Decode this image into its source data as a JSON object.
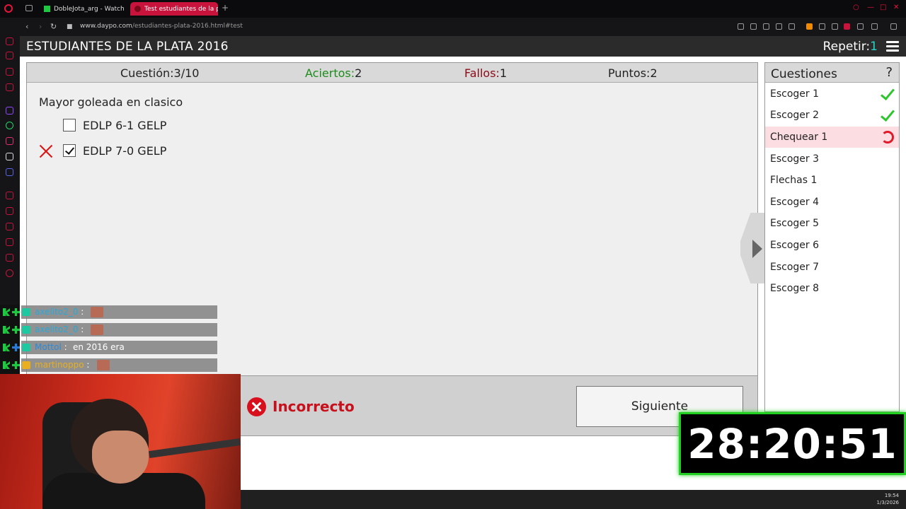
{
  "browser": {
    "tabs": [
      {
        "label": "DobleJota_arg - Watch clip",
        "active": false
      },
      {
        "label": "Test estudiantes de la plata",
        "active": true
      }
    ],
    "new_tab": "+",
    "url_host": "www.daypo.com",
    "url_path": "/estudiantes-plata-2016.html#test",
    "nav": {
      "back": "‹",
      "forward": "›",
      "reload": "↻"
    }
  },
  "header": {
    "title": "ESTUDIANTES DE LA PLATA 2016",
    "repeat_label": "Repetir:",
    "repeat_value": "1"
  },
  "stats": {
    "question_label": "Cuestión:",
    "question_value": "3/10",
    "correct_label": "Aciertos:",
    "correct_value": "2",
    "wrong_label": "Fallos:",
    "wrong_value": "1",
    "points_label": "Puntos:",
    "points_value": "2",
    "colors": {
      "correct": "#1c8c1c",
      "wrong": "#8b0b16"
    }
  },
  "question": {
    "text": "Mayor goleada en clasico",
    "options": [
      {
        "label": "EDLP 6-1 GELP",
        "checked": false,
        "marked_wrong": false
      },
      {
        "label": "EDLP 7-0 GELP",
        "checked": true,
        "marked_wrong": true
      }
    ]
  },
  "feedback": {
    "status": "Incorrecto",
    "next_button": "Siguiente"
  },
  "questions_panel": {
    "title": "Cuestiones",
    "help": "?",
    "items": [
      {
        "label": "Escoger 1",
        "state": "correct"
      },
      {
        "label": "Escoger 2",
        "state": "correct"
      },
      {
        "label": "Chequear 1",
        "state": "current"
      },
      {
        "label": "Escoger 3",
        "state": "pending"
      },
      {
        "label": "Flechas 1",
        "state": "pending"
      },
      {
        "label": "Escoger 4",
        "state": "pending"
      },
      {
        "label": "Escoger 5",
        "state": "pending"
      },
      {
        "label": "Escoger 6",
        "state": "pending"
      },
      {
        "label": "Escoger 7",
        "state": "pending"
      },
      {
        "label": "Escoger 8",
        "state": "pending"
      }
    ]
  },
  "chat": [
    {
      "user": "axelito2_0",
      "sep": " :",
      "message": "",
      "user_color": "#2aa8d8"
    },
    {
      "user": "axelito2_0",
      "sep": " :",
      "message": "",
      "user_color": "#2aa8d8"
    },
    {
      "user": "Mottol",
      "sep": " :",
      "message": " en 2016 era",
      "user_color": "#2a8ad8"
    },
    {
      "user": "martinoppo",
      "sep": " :",
      "message": "",
      "user_color": "#e8b020"
    }
  ],
  "timer": "28:20:51",
  "taskbar": {
    "time": "19:54",
    "date": "1/3/2026"
  }
}
